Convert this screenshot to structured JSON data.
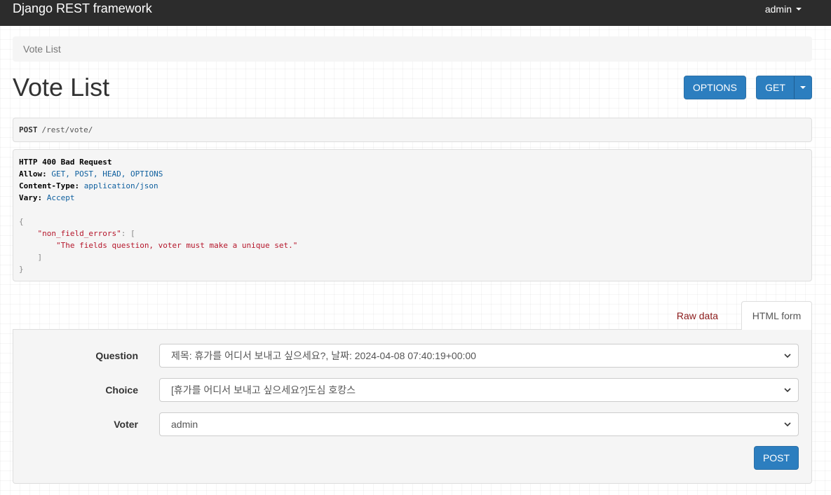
{
  "navbar": {
    "brand": "Django REST framework",
    "user": "admin"
  },
  "breadcrumb": {
    "current": "Vote List"
  },
  "page": {
    "title": "Vote List"
  },
  "actions": {
    "options_label": "OPTIONS",
    "get_label": "GET"
  },
  "request": {
    "method": "POST",
    "url": "/rest/vote/"
  },
  "response": {
    "status": "HTTP 400 Bad Request",
    "headers": [
      {
        "name": "Allow:",
        "value": "GET, POST, HEAD, OPTIONS"
      },
      {
        "name": "Content-Type:",
        "value": "application/json"
      },
      {
        "name": "Vary:",
        "value": "Accept"
      }
    ],
    "body": {
      "open_brace": "{",
      "key": "\"non_field_errors\"",
      "colon": ": ",
      "open_bracket": "[",
      "message": "\"The fields question, voter must make a unique set.\"",
      "close_bracket": "]",
      "close_brace": "}"
    }
  },
  "tabs": {
    "raw": "Raw data",
    "html": "HTML form"
  },
  "form": {
    "fields": [
      {
        "label": "Question",
        "value": "제목: 휴가를 어디서 보내고 싶으세요?, 날짜: 2024-04-08 07:40:19+00:00"
      },
      {
        "label": "Choice",
        "value": "[휴가를 어디서 보내고 싶으세요?]도심 호캉스"
      },
      {
        "label": "Voter",
        "value": "admin"
      }
    ],
    "submit_label": "POST"
  },
  "colors": {
    "navbar": "#2c2c2c",
    "primary": "#2c7ebf",
    "error": "#b5162b"
  }
}
